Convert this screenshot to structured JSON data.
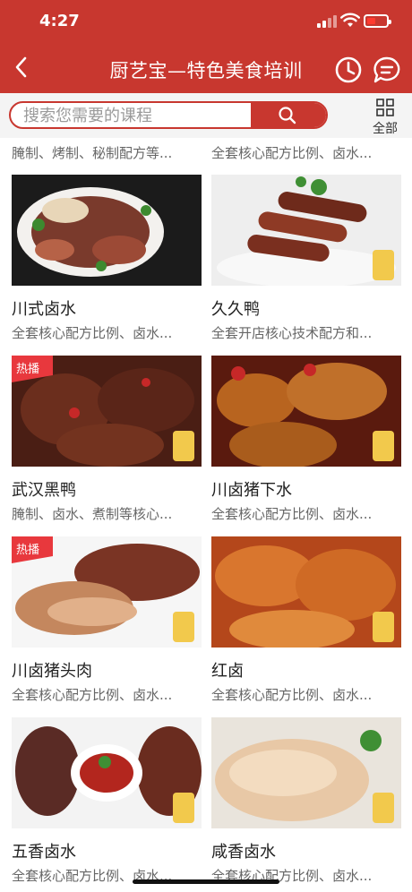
{
  "status": {
    "time": "4:27"
  },
  "nav": {
    "title": "厨艺宝—特色美食培训"
  },
  "search": {
    "placeholder": "搜索您需要的课程",
    "all_label": "全部"
  },
  "colors": {
    "brand": "#c8372f",
    "hot": "#e8383d"
  },
  "partial_row": [
    {
      "desc": "腌制、烤制、秘制配方等..."
    },
    {
      "desc": "全套核心配方比例、卤水..."
    }
  ],
  "courses": [
    {
      "name": "川式卤水",
      "desc": "全套核心配方比例、卤水...",
      "hot": false
    },
    {
      "name": "久久鸭",
      "desc": "全套开店核心技术配方和...",
      "hot": false
    },
    {
      "name": "武汉黑鸭",
      "desc": "腌制、卤水、煮制等核心...",
      "hot": true
    },
    {
      "name": "川卤猪下水",
      "desc": "全套核心配方比例、卤水...",
      "hot": false
    },
    {
      "name": "川卤猪头肉",
      "desc": "全套核心配方比例、卤水...",
      "hot": true
    },
    {
      "name": "红卤",
      "desc": "全套核心配方比例、卤水...",
      "hot": false
    },
    {
      "name": "五香卤水",
      "desc": "全套核心配方比例、卤水...",
      "hot": false
    },
    {
      "name": "咸香卤水",
      "desc": "全套核心配方比例、卤水...",
      "hot": false
    }
  ],
  "hot_badge": "热播",
  "icons": [
    "back-icon",
    "history-icon",
    "message-icon",
    "search-icon",
    "grid-icon"
  ]
}
